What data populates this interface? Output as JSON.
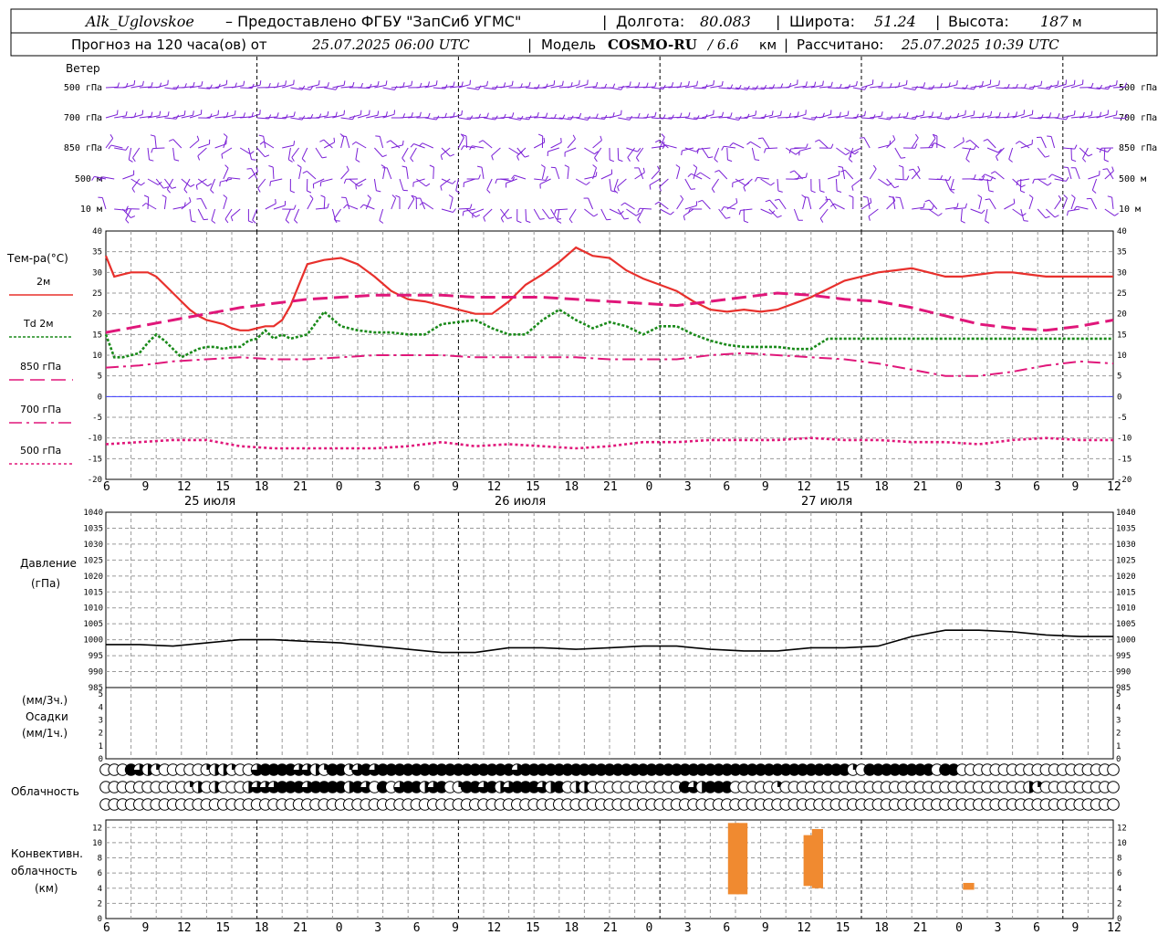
{
  "header": {
    "station": "Alk_Uglovskoe",
    "provided_by": "– Предоставлено ФГБУ \"ЗапСиб УГМС\"",
    "lon_label": "Долгота:",
    "lon_value": "80.083",
    "lat_label": "Широта:",
    "lat_value": "51.24",
    "alt_label": "Высота:",
    "alt_value": "187",
    "alt_unit": "м",
    "forecast_prefix": "Прогноз на 120 часа(ов) от",
    "forecast_time": "25.07.2025 06:00 UTC",
    "model_label": "Модель",
    "model_name": "COSMO-RU",
    "model_res": "/ 6.6",
    "model_res_unit": "км",
    "computed_label": "Рассчитано:",
    "computed_time": "25.07.2025 10:39 UTC"
  },
  "wind_panel": {
    "title": "Ветер",
    "levels": [
      "500 гПа",
      "700 гПа",
      "850 гПа",
      "500 м",
      "10 м"
    ],
    "color": "#7a1fd6"
  },
  "temp_panel": {
    "title": "Тем-ра(°C)",
    "legend": [
      {
        "label": "2м",
        "color": "#e8302c",
        "style": "solid"
      },
      {
        "label": "Td 2м",
        "color": "#1a8a1a",
        "style": "dotted"
      },
      {
        "label": "850 гПа",
        "color": "#e0177a",
        "style": "dash"
      },
      {
        "label": "700 гПа",
        "color": "#e0177a",
        "style": "dashdot"
      },
      {
        "label": "500 гПа",
        "color": "#e0177a",
        "style": "dot"
      }
    ],
    "y_ticks": [
      "40",
      "35",
      "30",
      "25",
      "20",
      "15",
      "10",
      "5",
      "0",
      "-5",
      "-10",
      "-15",
      "-20"
    ]
  },
  "x_axis": {
    "hour_labels": [
      "6",
      "9",
      "12",
      "15",
      "18",
      "21",
      "0",
      "3",
      "6",
      "9",
      "12",
      "15",
      "18",
      "21",
      "0",
      "3",
      "6",
      "9",
      "12",
      "15",
      "18",
      "21",
      "0",
      "3",
      "6",
      "9",
      "12"
    ],
    "date_labels": [
      "25 июля",
      "26 июля",
      "27 июля"
    ]
  },
  "pressure_panel": {
    "title1": "Давление",
    "title2": "(гПа)",
    "y_ticks": [
      "1040",
      "1035",
      "1030",
      "1025",
      "1020",
      "1015",
      "1010",
      "1005",
      "1000",
      "995",
      "990",
      "985"
    ]
  },
  "precip_panel": {
    "title1": "(мм/3ч.)",
    "title2": "Осадки",
    "title3": "(мм/1ч.)",
    "y_ticks": [
      "5",
      "4",
      "3",
      "2",
      "1",
      "0"
    ]
  },
  "cloud_panel": {
    "title": "Облачность",
    "rows": {
      "high": "0000000000000000000000000000000000000000000000000000000000000000000000000000000000000000000000000000000000000000000000000",
      "mid": "0000000000120200023334443444424304034423401443423444324022000000000004324440000010000000000000000000000000000021000000000",
      "low": "0004321000001221003444433214413434444444444444444344444444444444444444444444444444444444410444444440440000000000000000000"
    }
  },
  "conv_panel": {
    "title1": "Конвективн.",
    "title2": "облачность",
    "title3": "(км)",
    "y_ticks": [
      "12",
      "10",
      "8",
      "6",
      "4",
      "2",
      "0"
    ],
    "bar_color": "#f08a30"
  },
  "chart_data": [
    {
      "type": "line",
      "title": "Тем-ра(°C)",
      "x_unit": "hours from 25.07.2025 06:00 UTC",
      "ylim": [
        -20,
        40
      ],
      "series": [
        {
          "name": "2м",
          "x": [
            0,
            1,
            2,
            3,
            4,
            5,
            6,
            7,
            8,
            9,
            10,
            11,
            12,
            13,
            14,
            15,
            16,
            17,
            18,
            19,
            20,
            21,
            22,
            23,
            24,
            26,
            28,
            30,
            32,
            34,
            36,
            38,
            40,
            42,
            44,
            46,
            48,
            50,
            52,
            54,
            56,
            58,
            60,
            62,
            64,
            66,
            68,
            70,
            72,
            74,
            76,
            78,
            80,
            82,
            84,
            86,
            88,
            90,
            92,
            94,
            96,
            98,
            100,
            102,
            104,
            106,
            108,
            110,
            112,
            114,
            116,
            118,
            120
          ],
          "values": [
            34,
            29,
            29.5,
            30,
            30,
            30,
            29,
            27,
            25,
            23,
            21,
            19.5,
            18.5,
            18,
            17.5,
            16.5,
            16,
            16,
            16.5,
            17,
            17,
            18.5,
            22,
            27,
            32,
            33,
            33.5,
            32,
            29,
            25.5,
            23.5,
            23,
            22,
            21,
            20,
            20,
            23,
            27,
            29.5,
            32.5,
            36,
            34,
            33.5,
            30.5,
            28.5,
            27,
            25.5,
            23,
            21,
            20.5,
            21,
            20.5,
            21,
            22.5,
            24,
            26,
            28,
            29,
            30,
            30.5,
            31,
            30,
            29,
            29,
            29.5,
            30,
            30,
            29.5,
            29,
            29,
            29,
            29,
            29
          ]
        },
        {
          "name": "Td 2м",
          "x": [
            0,
            1,
            2,
            3,
            4,
            5,
            6,
            7,
            8,
            9,
            10,
            11,
            12,
            13,
            14,
            15,
            16,
            17,
            18,
            19,
            20,
            21,
            22,
            23,
            24,
            26,
            28,
            30,
            32,
            34,
            36,
            38,
            40,
            42,
            44,
            46,
            48,
            50,
            52,
            54,
            56,
            58,
            60,
            62,
            64,
            66,
            68,
            70,
            72,
            74,
            76,
            78,
            80,
            82,
            84,
            86,
            88,
            90,
            92,
            94,
            96,
            98,
            100,
            102,
            104,
            106,
            108,
            110,
            112,
            114,
            116,
            118,
            120
          ],
          "values": [
            15,
            9.5,
            9.5,
            10,
            10.5,
            13,
            15,
            13.5,
            11.5,
            9.5,
            10.5,
            11.5,
            12,
            12,
            11.5,
            12,
            12,
            13.5,
            14,
            16,
            14,
            15,
            14,
            14.5,
            15,
            20.5,
            17,
            16,
            15.5,
            15.5,
            15,
            15,
            17.5,
            18,
            18.5,
            16.5,
            15,
            15,
            18.5,
            21,
            18.5,
            16.5,
            18,
            17,
            15,
            17,
            17,
            15,
            13.5,
            12.5,
            12,
            12,
            12,
            11.5,
            11.5,
            14,
            14,
            14,
            14,
            14,
            14,
            14,
            14,
            14,
            14,
            14,
            14,
            14,
            14,
            14,
            14,
            14,
            14
          ]
        },
        {
          "name": "850 гПа",
          "x": [
            0,
            4,
            8,
            12,
            16,
            20,
            24,
            28,
            32,
            36,
            40,
            44,
            48,
            52,
            56,
            60,
            64,
            68,
            72,
            76,
            80,
            84,
            88,
            92,
            96,
            100,
            104,
            108,
            112,
            116,
            120
          ],
          "values": [
            15.5,
            17,
            18.5,
            20,
            21.5,
            22.5,
            23.5,
            24,
            24.5,
            24.5,
            24.5,
            24,
            24,
            24,
            23.5,
            23,
            22.5,
            22,
            23,
            24,
            25,
            24.5,
            23.5,
            23,
            21.5,
            19.5,
            17.5,
            16.5,
            16,
            17,
            18.5
          ]
        },
        {
          "name": "700 гПа",
          "x": [
            0,
            4,
            8,
            12,
            16,
            20,
            24,
            28,
            32,
            36,
            40,
            44,
            48,
            52,
            56,
            60,
            64,
            68,
            72,
            76,
            80,
            84,
            88,
            92,
            96,
            100,
            104,
            108,
            112,
            116,
            120
          ],
          "values": [
            7,
            7.5,
            8.5,
            9,
            9.5,
            9,
            9,
            9.5,
            10,
            10,
            10,
            9.5,
            9.5,
            9.5,
            9.5,
            9,
            9,
            9,
            10,
            10.5,
            10,
            9.5,
            9,
            8,
            6.5,
            5,
            5,
            6,
            7.5,
            8.5,
            8
          ]
        },
        {
          "name": "500 гПа",
          "x": [
            0,
            4,
            8,
            12,
            16,
            20,
            24,
            28,
            32,
            36,
            40,
            44,
            48,
            52,
            56,
            60,
            64,
            68,
            72,
            76,
            80,
            84,
            88,
            92,
            96,
            100,
            104,
            108,
            112,
            116,
            120
          ],
          "values": [
            -11.5,
            -11,
            -10.5,
            -10.5,
            -12,
            -12.5,
            -12.5,
            -12.5,
            -12.5,
            -12,
            -11,
            -12,
            -11.5,
            -12,
            -12.5,
            -12,
            -11,
            -11,
            -10.5,
            -10.5,
            -10.5,
            -10,
            -10.5,
            -10.5,
            -11,
            -11,
            -11.5,
            -10.5,
            -10,
            -10.5,
            -10.5
          ]
        }
      ]
    },
    {
      "type": "line",
      "title": "Давление (гПа)",
      "x_unit": "hours from 25.07.2025 06:00 UTC",
      "ylim": [
        985,
        1040
      ],
      "series": [
        {
          "name": "Давление",
          "x": [
            0,
            4,
            8,
            12,
            16,
            20,
            24,
            28,
            32,
            36,
            40,
            44,
            48,
            52,
            56,
            60,
            64,
            68,
            72,
            76,
            80,
            84,
            88,
            92,
            96,
            100,
            104,
            108,
            112,
            116,
            120
          ],
          "values": [
            998.5,
            998.5,
            998,
            999,
            1000,
            1000,
            999.5,
            999,
            998,
            997,
            996,
            996,
            997.5,
            997.5,
            997,
            997.5,
            998,
            998,
            997,
            996.5,
            996.5,
            997.5,
            997.5,
            998,
            1001,
            1003,
            1003,
            1002.5,
            1001.5,
            1001,
            1001
          ]
        }
      ]
    },
    {
      "type": "bar",
      "title": "Конвективн. облачность (км)",
      "x_unit": "hours from 25.07.2025 06:00 UTC",
      "ylim": [
        0,
        13
      ],
      "bars": [
        {
          "x_start": 74,
          "x_end": 75,
          "bottom": 3.2,
          "top": 12.6
        },
        {
          "x_start": 75,
          "x_end": 76,
          "bottom": 3.2,
          "top": 12.6
        },
        {
          "x_start": 83,
          "x_end": 84,
          "bottom": 4.3,
          "top": 11
        },
        {
          "x_start": 84,
          "x_end": 85,
          "bottom": 4,
          "top": 11.8
        },
        {
          "x_start": 102,
          "x_end": 103,
          "bottom": 3.8,
          "top": 4.7
        }
      ]
    }
  ]
}
